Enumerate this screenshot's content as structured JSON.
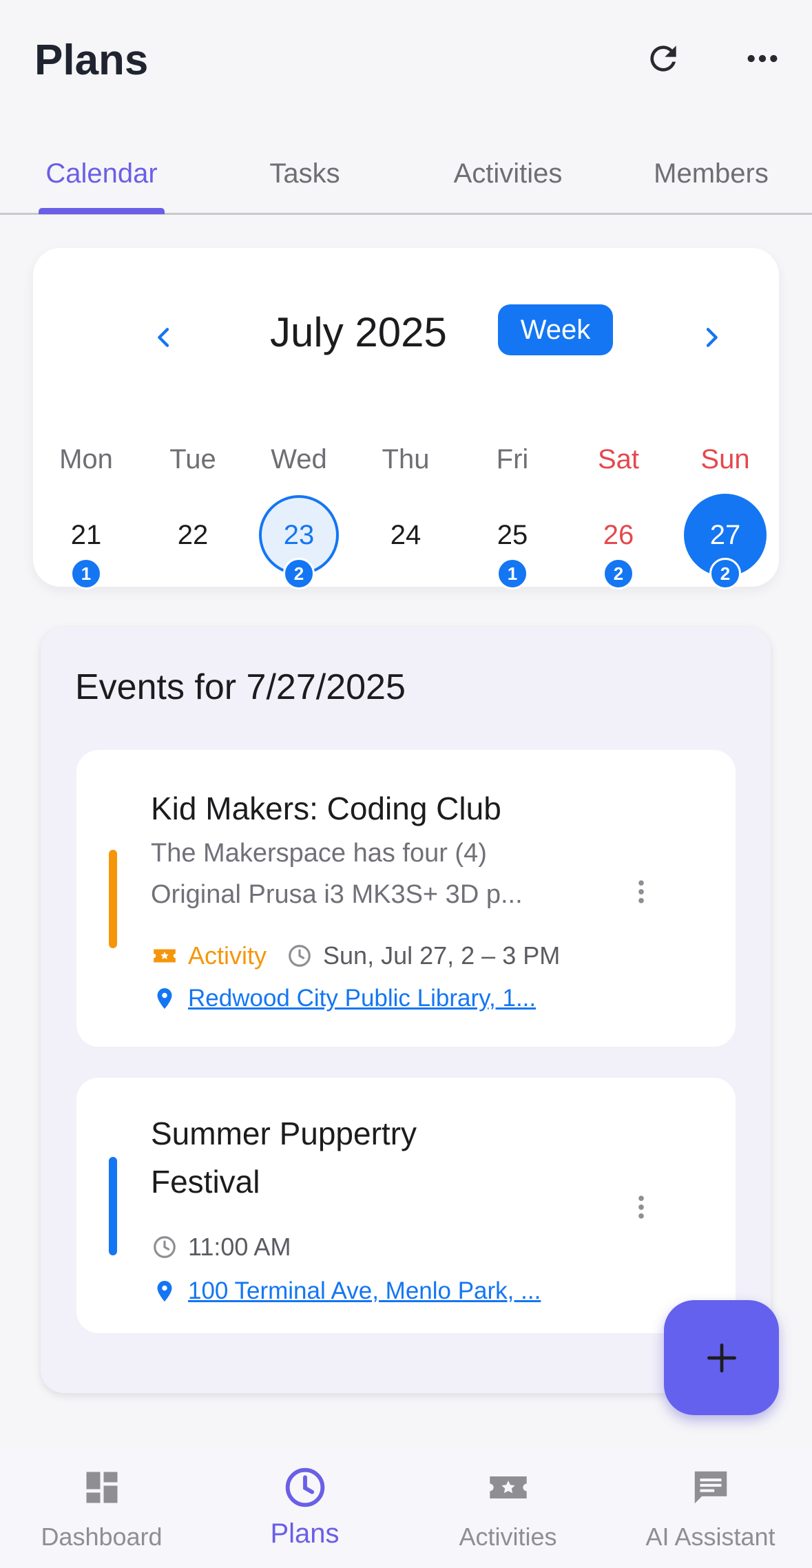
{
  "header": {
    "title": "Plans",
    "refresh_icon": "refresh-icon",
    "more_icon": "more-horizontal-icon"
  },
  "tabs": [
    {
      "label": "Calendar",
      "active": true
    },
    {
      "label": "Tasks",
      "active": false
    },
    {
      "label": "Activities",
      "active": false
    },
    {
      "label": "Members",
      "active": false
    }
  ],
  "calendar": {
    "month_label": "July 2025",
    "view_button": "Week",
    "days": [
      {
        "name": "Mon",
        "num": "21",
        "count": "1",
        "weekend": false
      },
      {
        "name": "Tue",
        "num": "22",
        "count": "",
        "weekend": false
      },
      {
        "name": "Wed",
        "num": "23",
        "count": "2",
        "weekend": false,
        "today": true
      },
      {
        "name": "Thu",
        "num": "24",
        "count": "",
        "weekend": false
      },
      {
        "name": "Fri",
        "num": "25",
        "count": "1",
        "weekend": false
      },
      {
        "name": "Sat",
        "num": "26",
        "count": "2",
        "weekend": true
      },
      {
        "name": "Sun",
        "num": "27",
        "count": "2",
        "weekend": true,
        "selected": true
      }
    ]
  },
  "events": {
    "title": "Events for 7/27/2025",
    "items": [
      {
        "title": "Kid Makers: Coding Club",
        "description_line1": "The Makerspace has four (4)",
        "description_line2": "Original Prusa i3 MK3S+ 3D p...",
        "type_label": "Activity",
        "time": "Sun, Jul 27, 2 – 3 PM",
        "location": "Redwood City Public Library, 1...",
        "bar_color": "#f5960a"
      },
      {
        "title_line1": "Summer Puppertry",
        "title_line2": "Festival",
        "time": "11:00 AM",
        "location": "100 Terminal Ave, Menlo Park, ...",
        "bar_color": "#1476f2"
      }
    ]
  },
  "fab": {
    "icon": "plus-icon"
  },
  "bottom_nav": [
    {
      "label": "Dashboard",
      "icon": "dashboard-icon",
      "active": false
    },
    {
      "label": "Plans",
      "icon": "clock-icon",
      "active": true
    },
    {
      "label": "Activities",
      "icon": "ticket-star-icon",
      "active": false
    },
    {
      "label": "AI Assistant",
      "icon": "chat-icon",
      "active": false
    }
  ],
  "colors": {
    "accent": "#6a5fe6",
    "primary_blue": "#1476f2",
    "weekend_red": "#e5484d",
    "activity_orange": "#f5960a"
  }
}
